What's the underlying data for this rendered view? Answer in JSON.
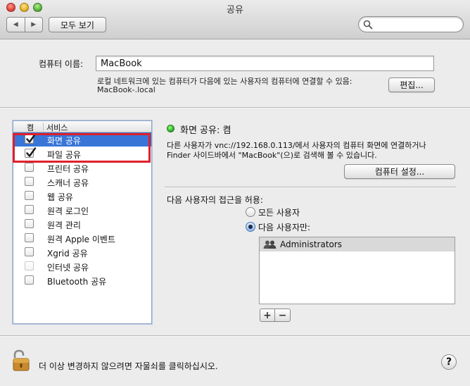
{
  "window": {
    "title": "공유"
  },
  "toolbar": {
    "back_icon": "◀",
    "forward_icon": "▶",
    "show_all_label": "모두 보기",
    "search_value": ""
  },
  "computer_name": {
    "label": "컴퓨터 이름:",
    "value": "MacBook",
    "description_line1": "로컬 네트워크에 있는 컴퓨터가 다음에 있는 사용자의 컴퓨터에 연결할 수 있음:",
    "description_line2": "MacBook-.local",
    "edit_button": "편집..."
  },
  "services": {
    "col_on": "켬",
    "col_service": "서비스",
    "items": [
      {
        "label": "화면 공유",
        "checked": true,
        "selected": true,
        "disabled": false
      },
      {
        "label": "파일 공유",
        "checked": true,
        "selected": false,
        "disabled": false
      },
      {
        "label": "프린터 공유",
        "checked": false,
        "selected": false,
        "disabled": false
      },
      {
        "label": "스캐너 공유",
        "checked": false,
        "selected": false,
        "disabled": false
      },
      {
        "label": "웹 공유",
        "checked": false,
        "selected": false,
        "disabled": false
      },
      {
        "label": "원격 로그인",
        "checked": false,
        "selected": false,
        "disabled": false
      },
      {
        "label": "원격 관리",
        "checked": false,
        "selected": false,
        "disabled": false
      },
      {
        "label": "원격 Apple 이벤트",
        "checked": false,
        "selected": false,
        "disabled": false
      },
      {
        "label": "Xgrid 공유",
        "checked": false,
        "selected": false,
        "disabled": false
      },
      {
        "label": "인터넷 공유",
        "checked": false,
        "selected": false,
        "disabled": true
      },
      {
        "label": "Bluetooth 공유",
        "checked": false,
        "selected": false,
        "disabled": false
      }
    ]
  },
  "detail": {
    "status": "화면 공유: 켬",
    "status_color": "#2fb12f",
    "line1": "다른 사용자가 vnc://192.168.0.113/에서 사용자의 컴퓨터 화면에 연결하거나",
    "line2": "Finder 사이드바에서 \"MacBook\"(으)로 검색해 볼 수 있습니다.",
    "settings_button": "컴퓨터 설정...",
    "allow_label": "다음 사용자의 접근을 허용:",
    "radio_all": "모든 사용자",
    "radio_only": "다음 사용자만:",
    "selected_radio": "only",
    "users": [
      "Administrators"
    ],
    "add_label": "+",
    "remove_label": "−"
  },
  "footer": {
    "lock_text": "더 이상 변경하지 않으려면 자물쇠를 클릭하십시오.",
    "help_label": "?"
  },
  "colors": {
    "selection": "#3875d7",
    "highlight_box": "#e0202a"
  }
}
